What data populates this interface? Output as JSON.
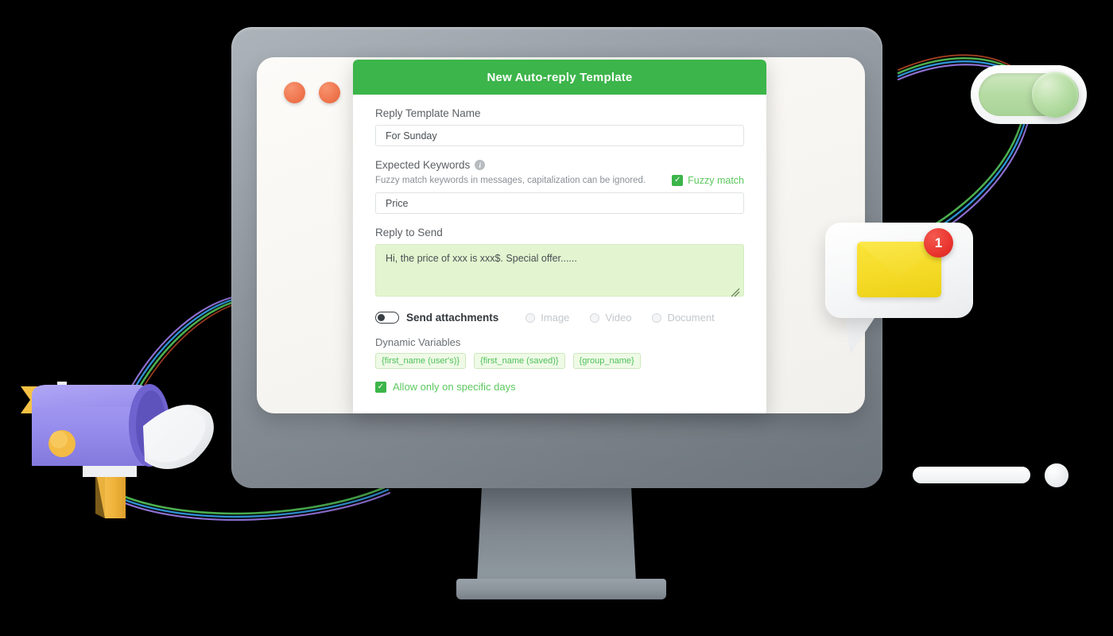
{
  "modal": {
    "title": "New Auto-reply Template",
    "accent_color": "#3cb54a",
    "fields": {
      "template_name": {
        "label": "Reply Template Name",
        "value": "For Sunday",
        "placeholder": "For Sunday"
      },
      "expected_keywords": {
        "label": "Expected Keywords",
        "info_icon": "info-icon",
        "hint": "Fuzzy match keywords in messages, capitalization can be ignored.",
        "fuzzy_match_label": "Fuzzy match",
        "fuzzy_match_checked": true,
        "check_glyph": "✓",
        "value": "Price",
        "placeholder": "Price"
      },
      "reply_to_send": {
        "label": "Reply to Send",
        "value": "Hi, the price of xxx is xxx$. Special offer......",
        "placeholder": "Hi, the price of xxx is xxx$. Special offer......",
        "background_color": "#e2f5d0"
      }
    },
    "attachments": {
      "toggle_label": "Send attachments",
      "toggle_on": false,
      "options": [
        {
          "label": "Image",
          "selected": false,
          "disabled": true
        },
        {
          "label": "Video",
          "selected": false,
          "disabled": true
        },
        {
          "label": "Document",
          "selected": false,
          "disabled": true
        }
      ]
    },
    "dynamic_variables": {
      "label": "Dynamic Variables",
      "chips": [
        "{first_name (user's)}",
        "{first_name (saved)}",
        "{group_name}"
      ]
    },
    "allow_specific_days": {
      "label": "Allow only on specific days",
      "checked": true,
      "check_glyph": "✓"
    }
  },
  "window": {
    "dots": [
      "window-dot-1",
      "window-dot-2"
    ],
    "dot_color": "#f0764e"
  },
  "decorations": {
    "toggle_switch": {
      "name": "toggle-switch-3d",
      "state": "on",
      "track_color": "#b6dca4"
    },
    "message_bubble": {
      "name": "message-bubble-3d",
      "envelope_color": "#f5db27",
      "badge_count": "1",
      "badge_color": "#e8322c"
    },
    "mailbox": {
      "name": "mailbox-3d",
      "body_color": "#9b93ec",
      "flag_color": "#f6c244",
      "post_color": "#f3b93d"
    },
    "monitor": {
      "name": "computer-monitor",
      "bezel_color": "#8d959d"
    }
  }
}
